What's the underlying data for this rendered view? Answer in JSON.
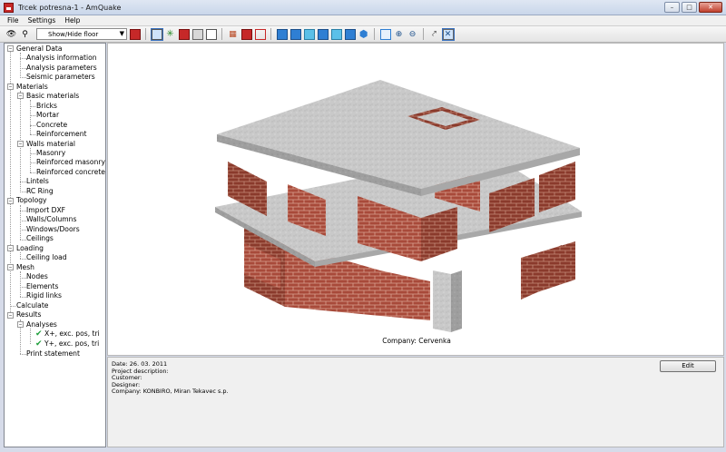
{
  "window": {
    "title": "Trcek potresna-1 - AmQuake",
    "controls": [
      "minimize",
      "maximize",
      "close"
    ]
  },
  "menu": {
    "items": [
      {
        "label": "File"
      },
      {
        "label": "Settings"
      },
      {
        "label": "Help"
      }
    ]
  },
  "toolbar": {
    "floor_select_value": "Show/Hide floor"
  },
  "tree": {
    "items": [
      {
        "label": "General Data",
        "level": 0
      },
      {
        "label": "Analysis information",
        "level": 1
      },
      {
        "label": "Analysis parameters",
        "level": 1
      },
      {
        "label": "Seismic parameters",
        "level": 1
      },
      {
        "label": "Materials",
        "level": 0
      },
      {
        "label": "Basic materials",
        "level": 1
      },
      {
        "label": "Bricks",
        "level": 2
      },
      {
        "label": "Mortar",
        "level": 2
      },
      {
        "label": "Concrete",
        "level": 2
      },
      {
        "label": "Reinforcement",
        "level": 2
      },
      {
        "label": "Walls material",
        "level": 1
      },
      {
        "label": "Masonry",
        "level": 2
      },
      {
        "label": "Reinforced masonry",
        "level": 2
      },
      {
        "label": "Reinforced concrete",
        "level": 2
      },
      {
        "label": "Lintels",
        "level": 1
      },
      {
        "label": "RC Ring",
        "level": 1
      },
      {
        "label": "Topology",
        "level": 0
      },
      {
        "label": "Import DXF",
        "level": 1
      },
      {
        "label": "Walls/Columns",
        "level": 1
      },
      {
        "label": "Windows/Doors",
        "level": 1
      },
      {
        "label": "Ceilings",
        "level": 1
      },
      {
        "label": "Loading",
        "level": 0
      },
      {
        "label": "Ceiling load",
        "level": 1
      },
      {
        "label": "Mesh",
        "level": 0
      },
      {
        "label": "Nodes",
        "level": 1
      },
      {
        "label": "Elements",
        "level": 1
      },
      {
        "label": "Rigid links",
        "level": 1
      },
      {
        "label": "Calculate",
        "level": 0
      },
      {
        "label": "Results",
        "level": 0
      },
      {
        "label": "Analyses",
        "level": 1
      },
      {
        "label": "X+, exc. pos, tri",
        "level": 2,
        "checked": true
      },
      {
        "label": "Y+, exc. pos, tri",
        "level": 2,
        "checked": true
      },
      {
        "label": "Print statement",
        "level": 1
      }
    ]
  },
  "view": {
    "company_caption": "Company: Cervenka"
  },
  "info": {
    "date": "Date: 26. 03. 2011",
    "project_description": "Project description:",
    "customer": "Customer:",
    "designer": "Designer:",
    "company": "Company: KONBIRO, Miran Tekavec s.p.",
    "edit_label": "Edit"
  },
  "colors": {
    "brick": "#a84a3a",
    "slab": "#c8c8c8",
    "column": "#8a8a8a",
    "accent": "#c62828"
  }
}
